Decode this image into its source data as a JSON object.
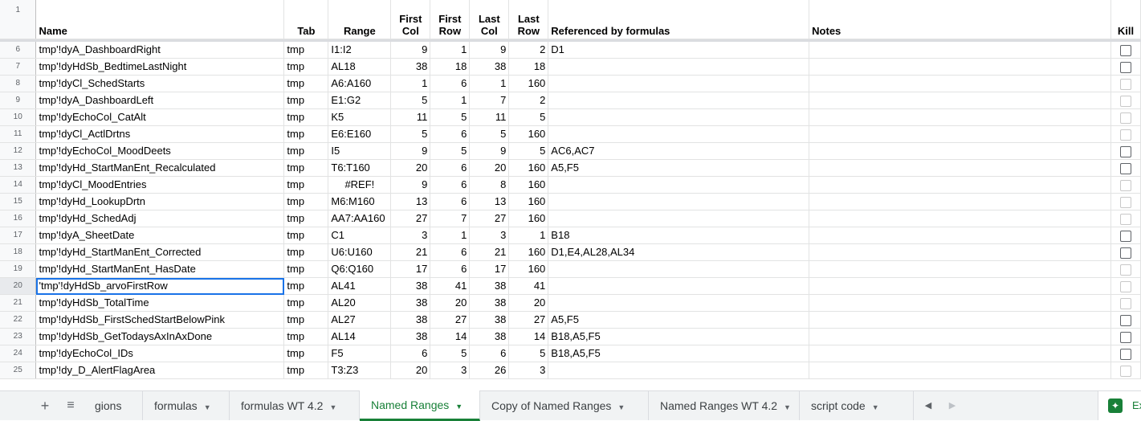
{
  "headers": {
    "row_num": "1",
    "name": "Name",
    "tab": "Tab",
    "range": "Range",
    "first_col": [
      "First",
      "Col"
    ],
    "first_row": [
      "First",
      "Row"
    ],
    "last_col": [
      "Last",
      "Col"
    ],
    "last_row": [
      "Last",
      "Row"
    ],
    "referenced": "Referenced by formulas",
    "notes": "Notes",
    "kill": "Kill"
  },
  "rows": [
    {
      "n": "6",
      "name": "tmp'!dyA_DashboardRight",
      "tab": "tmp",
      "range": "I1:I2",
      "fc": "9",
      "fr": "1",
      "lc": "9",
      "lr": "2",
      "ref": "D1",
      "notes": "",
      "kill": "dark"
    },
    {
      "n": "7",
      "name": "tmp'!dyHdSb_BedtimeLastNight",
      "tab": "tmp",
      "range": "AL18",
      "fc": "38",
      "fr": "18",
      "lc": "38",
      "lr": "18",
      "ref": "",
      "notes": "",
      "kill": "dark"
    },
    {
      "n": "8",
      "name": "tmp'!dyCl_SchedStarts",
      "tab": "tmp",
      "range": "A6:A160",
      "fc": "1",
      "fr": "6",
      "lc": "1",
      "lr": "160",
      "ref": "",
      "notes": "",
      "kill": "light"
    },
    {
      "n": "9",
      "name": "tmp'!dyA_DashboardLeft",
      "tab": "tmp",
      "range": "E1:G2",
      "fc": "5",
      "fr": "1",
      "lc": "7",
      "lr": "2",
      "ref": "",
      "notes": "",
      "kill": "light"
    },
    {
      "n": "10",
      "name": "tmp'!dyEchoCol_CatAlt",
      "tab": "tmp",
      "range": "K5",
      "fc": "11",
      "fr": "5",
      "lc": "11",
      "lr": "5",
      "ref": "",
      "notes": "",
      "kill": "light"
    },
    {
      "n": "11",
      "name": "tmp'!dyCl_ActlDrtns",
      "tab": "tmp",
      "range": "E6:E160",
      "fc": "5",
      "fr": "6",
      "lc": "5",
      "lr": "160",
      "ref": "",
      "notes": "",
      "kill": "light"
    },
    {
      "n": "12",
      "name": "tmp'!dyEchoCol_MoodDeets",
      "tab": "tmp",
      "range": "I5",
      "fc": "9",
      "fr": "5",
      "lc": "9",
      "lr": "5",
      "ref": "AC6,AC7",
      "notes": "",
      "kill": "dark"
    },
    {
      "n": "13",
      "name": "tmp'!dyHd_StartManEnt_Recalculated",
      "tab": "tmp",
      "range": "T6:T160",
      "fc": "20",
      "fr": "6",
      "lc": "20",
      "lr": "160",
      "ref": "A5,F5",
      "notes": "",
      "kill": "dark"
    },
    {
      "n": "14",
      "name": "tmp'!dyCl_MoodEntries",
      "tab": "tmp",
      "range": "#REF!",
      "fc": "9",
      "fr": "6",
      "lc": "8",
      "lr": "160",
      "ref": "",
      "notes": "",
      "kill": "light",
      "range_center": true
    },
    {
      "n": "15",
      "name": "tmp'!dyHd_LookupDrtn",
      "tab": "tmp",
      "range": "M6:M160",
      "fc": "13",
      "fr": "6",
      "lc": "13",
      "lr": "160",
      "ref": "",
      "notes": "",
      "kill": "light"
    },
    {
      "n": "16",
      "name": "tmp'!dyHd_SchedAdj",
      "tab": "tmp",
      "range": "AA7:AA160",
      "fc": "27",
      "fr": "7",
      "lc": "27",
      "lr": "160",
      "ref": "",
      "notes": "",
      "kill": "light"
    },
    {
      "n": "17",
      "name": "tmp'!dyA_SheetDate",
      "tab": "tmp",
      "range": "C1",
      "fc": "3",
      "fr": "1",
      "lc": "3",
      "lr": "1",
      "ref": "B18",
      "notes": "",
      "kill": "dark"
    },
    {
      "n": "18",
      "name": "tmp'!dyHd_StartManEnt_Corrected",
      "tab": "tmp",
      "range": "U6:U160",
      "fc": "21",
      "fr": "6",
      "lc": "21",
      "lr": "160",
      "ref": "D1,E4,AL28,AL34",
      "notes": "",
      "kill": "dark"
    },
    {
      "n": "19",
      "name": "tmp'!dyHd_StartManEnt_HasDate",
      "tab": "tmp",
      "range": "Q6:Q160",
      "fc": "17",
      "fr": "6",
      "lc": "17",
      "lr": "160",
      "ref": "",
      "notes": "",
      "kill": "light"
    },
    {
      "n": "20",
      "name": "'tmp'!dyHdSb_arvoFirstRow",
      "tab": "tmp",
      "range": "AL41",
      "fc": "38",
      "fr": "41",
      "lc": "38",
      "lr": "41",
      "ref": "",
      "notes": "",
      "kill": "light",
      "selected": true
    },
    {
      "n": "21",
      "name": "tmp'!dyHdSb_TotalTime",
      "tab": "tmp",
      "range": "AL20",
      "fc": "38",
      "fr": "20",
      "lc": "38",
      "lr": "20",
      "ref": "",
      "notes": "",
      "kill": "light"
    },
    {
      "n": "22",
      "name": "tmp'!dyHdSb_FirstSchedStartBelowPink",
      "tab": "tmp",
      "range": "AL27",
      "fc": "38",
      "fr": "27",
      "lc": "38",
      "lr": "27",
      "ref": "A5,F5",
      "notes": "",
      "kill": "dark"
    },
    {
      "n": "23",
      "name": "tmp'!dyHdSb_GetTodaysAxInAxDone",
      "tab": "tmp",
      "range": "AL14",
      "fc": "38",
      "fr": "14",
      "lc": "38",
      "lr": "14",
      "ref": "B18,A5,F5",
      "notes": "",
      "kill": "dark"
    },
    {
      "n": "24",
      "name": "tmp'!dyEchoCol_IDs",
      "tab": "tmp",
      "range": "F5",
      "fc": "6",
      "fr": "5",
      "lc": "6",
      "lr": "5",
      "ref": "B18,A5,F5",
      "notes": "",
      "kill": "dark"
    },
    {
      "n": "25",
      "name": "tmp'!dy_D_AlertFlagArea",
      "tab": "tmp",
      "range": "T3:Z3",
      "fc": "20",
      "fr": "3",
      "lc": "26",
      "lr": "3",
      "ref": "",
      "notes": "",
      "kill": "light"
    }
  ],
  "tabs": {
    "add_icon": "plus-icon",
    "list_icon": "sheet-list-icon",
    "items": [
      {
        "label": "gions",
        "active": false
      },
      {
        "label": "formulas",
        "active": false
      },
      {
        "label": "formulas WT 4.2",
        "active": false
      },
      {
        "label": "Named Ranges",
        "active": true
      },
      {
        "label": "Copy of Named Ranges",
        "active": false
      },
      {
        "label": "Named Ranges WT 4.2",
        "active": false
      },
      {
        "label": "script code",
        "active": false
      }
    ],
    "explore_label": "Ex"
  },
  "colors": {
    "accent_green": "#188038",
    "selection_blue": "#1a73e8"
  }
}
